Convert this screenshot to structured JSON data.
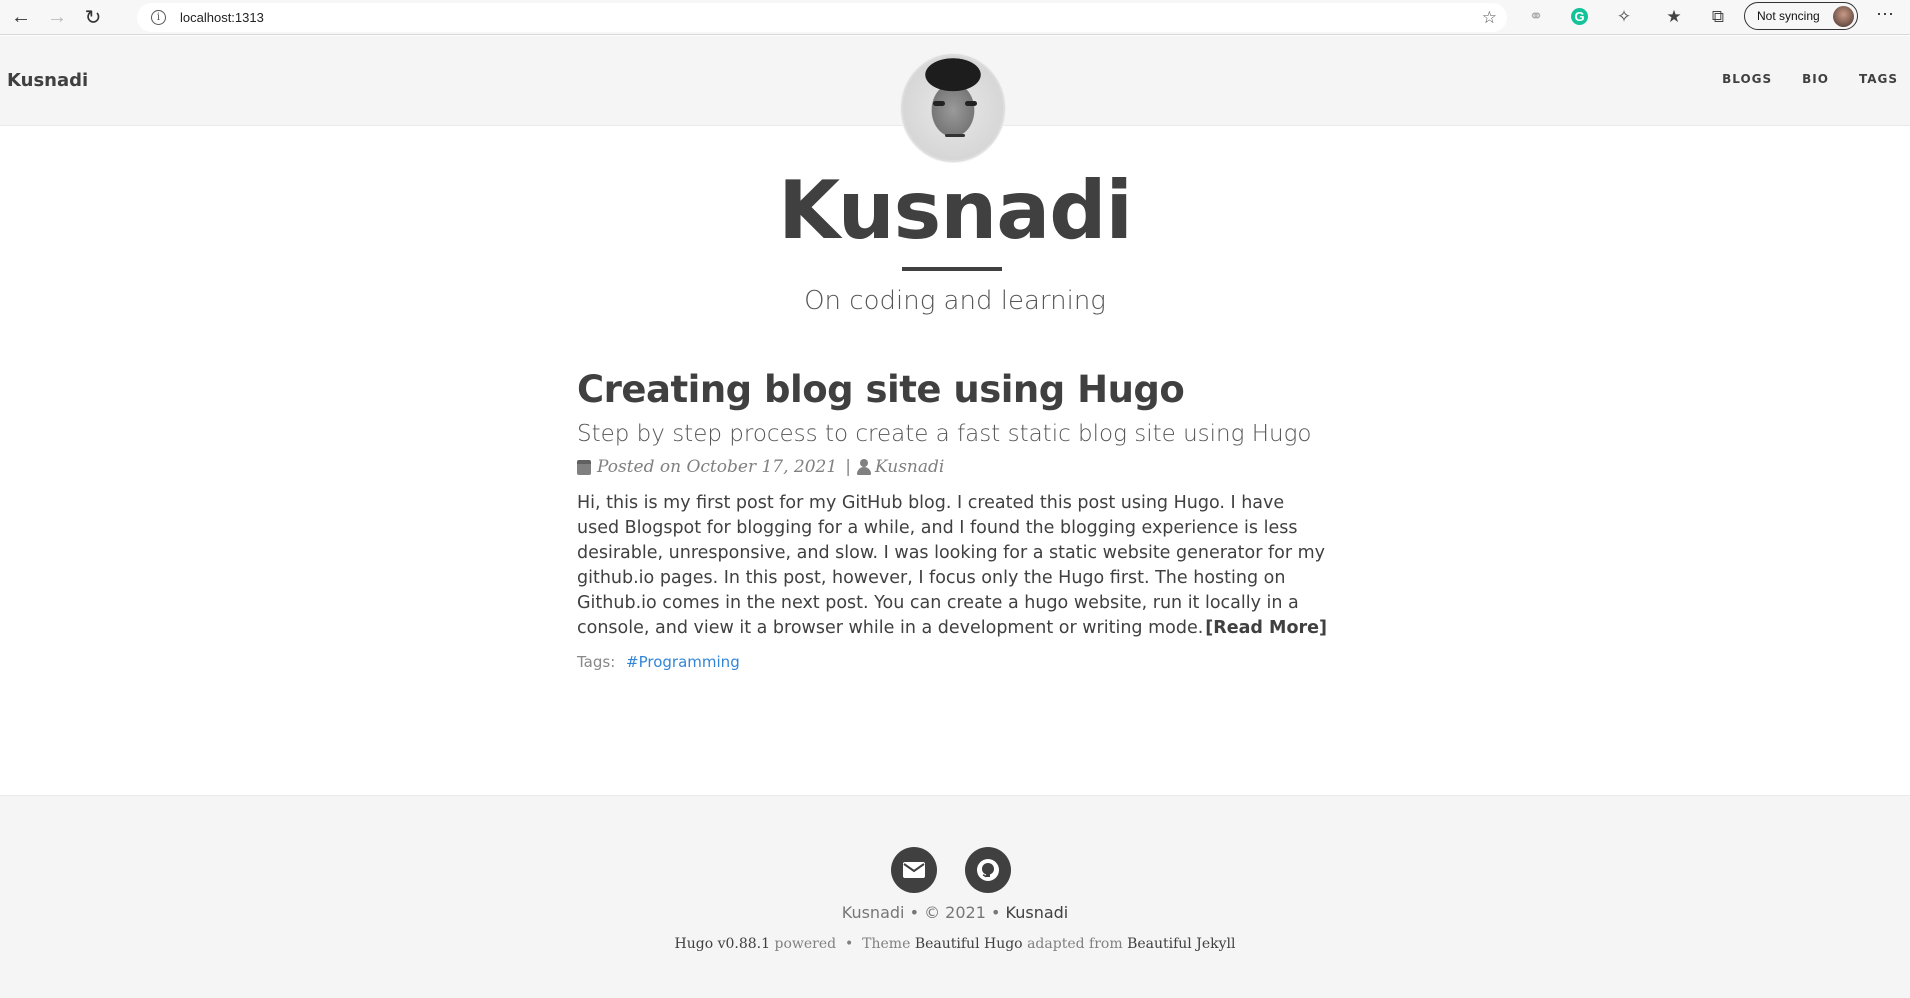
{
  "browser": {
    "url": "localhost:1313",
    "sync_label": "Not syncing"
  },
  "navbar": {
    "brand": "Kusnadi",
    "items": [
      "BLOGS",
      "BIO",
      "TAGS"
    ]
  },
  "header": {
    "title": "Kusnadi",
    "subtitle": "On coding and learning"
  },
  "post": {
    "title": "Creating blog site using Hugo",
    "subtitle": "Step by step process to create a fast static blog site using Hugo",
    "meta_date": "Posted on October 17, 2021",
    "meta_separator": "|",
    "meta_author": "Kusnadi",
    "excerpt": "Hi, this is my first post for my GitHub blog. I created this post using Hugo. I have used Blogspot for blogging for a while, and I found the blogging experience is less desirable, unresponsive, and slow. I was looking for a static website generator for my github.io pages. In this post, however, I focus only the Hugo first. The hosting on Github.io comes in the next post. You can create a hugo website, run it locally in a console, and view it a browser while in a development or writing mode.",
    "read_more": "[Read More]",
    "tags_label": "Tags:",
    "tags": [
      "#Programming"
    ]
  },
  "footer": {
    "social_icons": [
      "email-icon",
      "github-icon"
    ],
    "copyright_name": "Kusnadi",
    "copyright_year": "• © 2021",
    "copyright_sep": "•",
    "copyright_author": "Kusnadi",
    "credits": {
      "hugo": "Hugo v0.88.1",
      "powered": "powered",
      "sep": "•",
      "theme_prefix": "Theme",
      "theme_name": "Beautiful Hugo",
      "adapted": "adapted from",
      "original": "Beautiful Jekyll"
    }
  },
  "colors": {
    "text": "#404040",
    "link": "#3385d6",
    "footer_bg": "#f5f5f5"
  }
}
